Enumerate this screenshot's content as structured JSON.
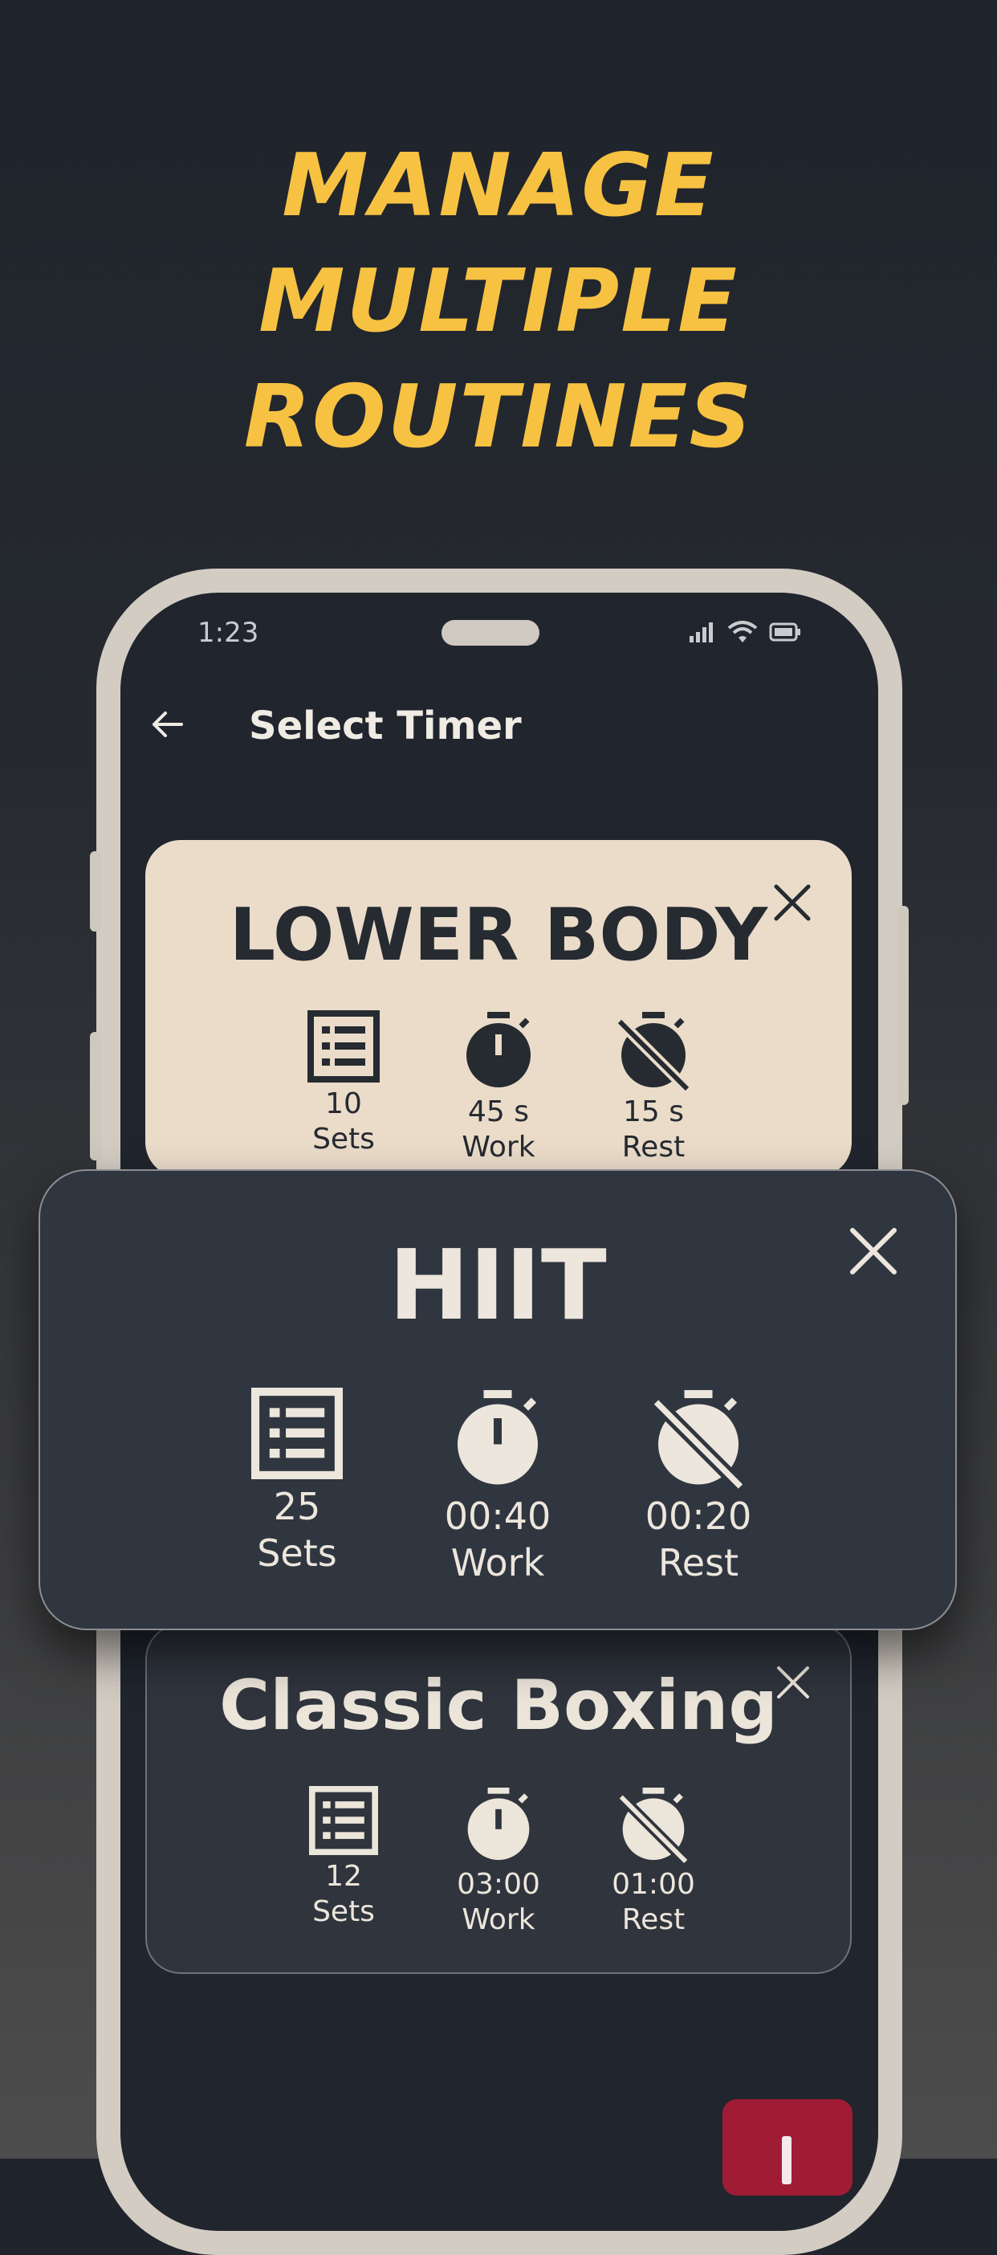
{
  "headline": [
    "MANAGE",
    "MULTIPLE",
    "ROUTINES"
  ],
  "status_bar": {
    "time": "1:23",
    "icons": [
      "signal-icon",
      "wifi-icon",
      "battery-icon"
    ]
  },
  "header": {
    "back_icon": "arrow-left-icon",
    "title": "Select Timer"
  },
  "timers": [
    {
      "name": "LOWER BODY",
      "stats": [
        {
          "icon": "list-icon",
          "value": "10",
          "label": "Sets"
        },
        {
          "icon": "stopwatch-icon",
          "value": "45 s",
          "label": "Work"
        },
        {
          "icon": "stopwatch-off-icon",
          "value": "15 s",
          "label": "Rest"
        }
      ]
    },
    {
      "name": "HIIT",
      "stats": [
        {
          "icon": "list-icon",
          "value": "25",
          "label": "Sets"
        },
        {
          "icon": "stopwatch-icon",
          "value": "00:40",
          "label": "Work"
        },
        {
          "icon": "stopwatch-off-icon",
          "value": "00:20",
          "label": "Rest"
        }
      ]
    },
    {
      "name": "Classic Boxing",
      "stats": [
        {
          "icon": "list-icon",
          "value": "12",
          "label": "Sets"
        },
        {
          "icon": "stopwatch-icon",
          "value": "03:00",
          "label": "Work"
        },
        {
          "icon": "stopwatch-off-icon",
          "value": "01:00",
          "label": "Rest"
        }
      ]
    }
  ],
  "fab": {
    "icon": "plus-icon"
  },
  "colors": {
    "headline": "#f7c242",
    "card_light": "#eadcc9",
    "card_dark": "#2f343d",
    "fab": "#a01c34"
  }
}
